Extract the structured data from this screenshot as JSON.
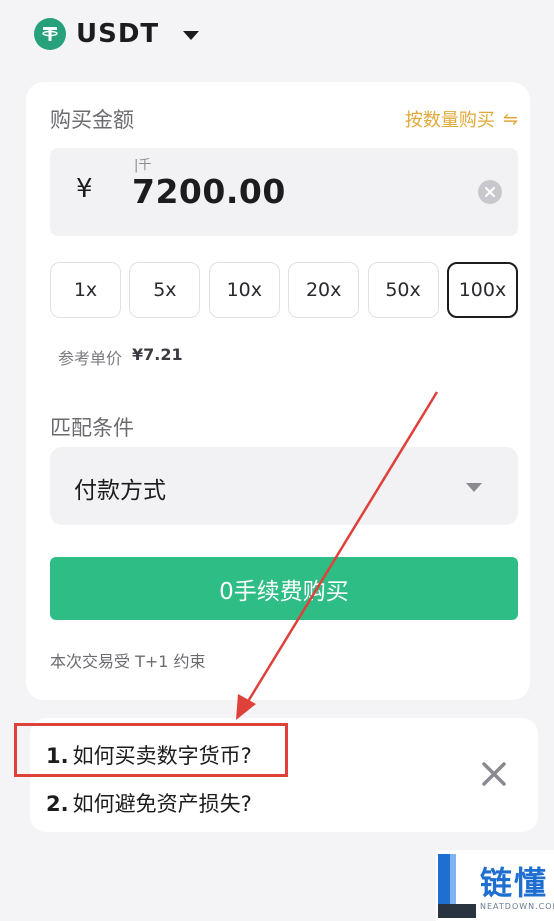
{
  "header": {
    "coin": "USDT"
  },
  "buy_card": {
    "amount_title": "购买金额",
    "switch_label": "按数量购买",
    "switch_icon": "⇋",
    "currency_symbol": "¥",
    "unit_hint": "|千",
    "amount_value": "7200.00",
    "multipliers": [
      "1x",
      "5x",
      "10x",
      "20x",
      "50x",
      "100x"
    ],
    "active_multiplier": "100x",
    "ref_price_label": "参考单价",
    "ref_price_value": "¥7.21",
    "match_title": "匹配条件",
    "payment_label": "付款方式",
    "buy_button": "0手续费购买",
    "note": "本次交易受 T+1 约束"
  },
  "faq": {
    "items": [
      {
        "num": "1.",
        "text": "如何买卖数字货币?"
      },
      {
        "num": "2.",
        "text": "如何避免资产损失?"
      }
    ]
  },
  "watermark": {
    "text": "链懂",
    "sub": "NEATDOWN.COM"
  },
  "colors": {
    "accent_green": "#2ebd85",
    "tether_green": "#26a17b",
    "link_gold": "#e0a93a",
    "annotation_red": "#e0403a"
  }
}
